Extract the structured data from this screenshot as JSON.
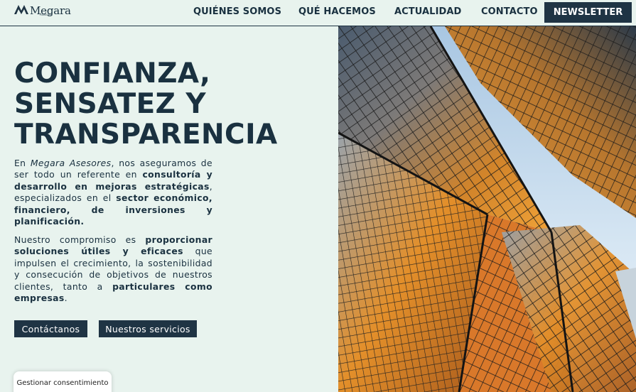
{
  "header": {
    "logo_text": "Megara",
    "logo_subtext": "Asesores",
    "nav": [
      "QUIÉNES SOMOS",
      "QUÉ HACEMOS",
      "ACTUALIDAD",
      "CONTACTO"
    ],
    "newsletter": "NEWSLETTER"
  },
  "hero": {
    "title": [
      "CONFIANZA,",
      "SENSATEZ Y",
      "TRANSPARENCIA"
    ],
    "p1": {
      "t1": "En ",
      "brand": "Megara Asesores",
      "t2": ", nos aseguramos de ser todo un referente en ",
      "b1": "consultoría y desarrollo en mejoras estratégicas",
      "t3": ", especializados en el ",
      "b2": "sector económico, financiero, de inversiones y planificación."
    },
    "p2": {
      "t1": "Nuestro compromiso es ",
      "b1": "proporcionar soluciones útiles y eficaces",
      "t2": " que impulsen el crecimiento, la sostenibilidad y consecución de objetivos de nuestros clientes, tanto a ",
      "b2": "particulares como empresas",
      "t3": "."
    },
    "buttons": [
      "Contáctanos",
      "Nuestros servicios"
    ]
  },
  "consent": "Gestionar consentimiento",
  "colors": {
    "background": "#e8f3ee",
    "navy": "#1f3444",
    "text": "#1a3140"
  },
  "photo": {
    "icon": "skyscrapers-image"
  }
}
